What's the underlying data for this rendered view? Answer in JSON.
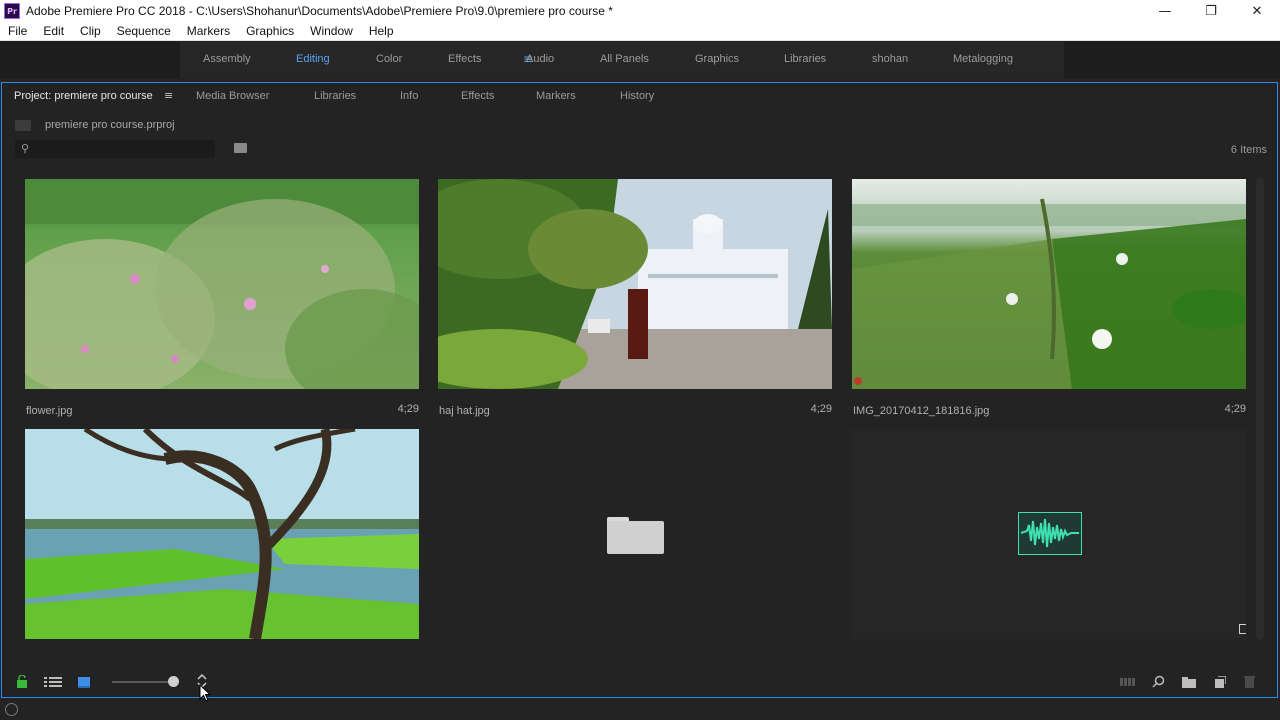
{
  "window": {
    "title": "Adobe Premiere Pro CC 2018 - C:\\Users\\Shohanur\\Documents\\Adobe\\Premiere Pro\\9.0\\premiere pro course *",
    "app_icon_text": "Pr",
    "minimize": "—",
    "restore": "❐",
    "close": "✕"
  },
  "menu": [
    "File",
    "Edit",
    "Clip",
    "Sequence",
    "Markers",
    "Graphics",
    "Window",
    "Help"
  ],
  "workspaces": {
    "tabs": [
      "Assembly",
      "Editing",
      "Color",
      "Effects",
      "Audio",
      "All Panels",
      "Graphics",
      "Libraries",
      "shohan",
      "Metalogging"
    ],
    "active": "Editing",
    "menu_icon": "≡"
  },
  "panel": {
    "tabs": [
      "Project: premiere pro course",
      "Media Browser",
      "Libraries",
      "Info",
      "Effects",
      "Markers",
      "History"
    ],
    "menu_icon": "≡",
    "breadcrumb": "premiere pro course.prproj",
    "search_placeholder": "",
    "search_icon": "⚲",
    "items_count": "6 Items"
  },
  "project_items": [
    {
      "name": "flower.jpg",
      "duration": "4;29",
      "kind": "image"
    },
    {
      "name": "haj hat.jpg",
      "duration": "4;29",
      "kind": "image"
    },
    {
      "name": "IMG_20170412_181816.jpg",
      "duration": "4;29",
      "kind": "image"
    },
    {
      "name": "",
      "duration": "",
      "kind": "image"
    },
    {
      "name": "",
      "duration": "",
      "kind": "bin"
    },
    {
      "name": "",
      "duration": "",
      "kind": "audio"
    }
  ],
  "colors": {
    "accent": "#5aa2f5",
    "panel_border": "#2d8ceb",
    "audio_wave": "#3fe0b0"
  },
  "bottom_icons": [
    "lock-icon",
    "list-view-icon",
    "icon-view-icon",
    "zoom-slider",
    "sort-icon",
    "automate-icon",
    "find-icon",
    "new-bin-icon",
    "new-item-icon",
    "clear-icon"
  ]
}
